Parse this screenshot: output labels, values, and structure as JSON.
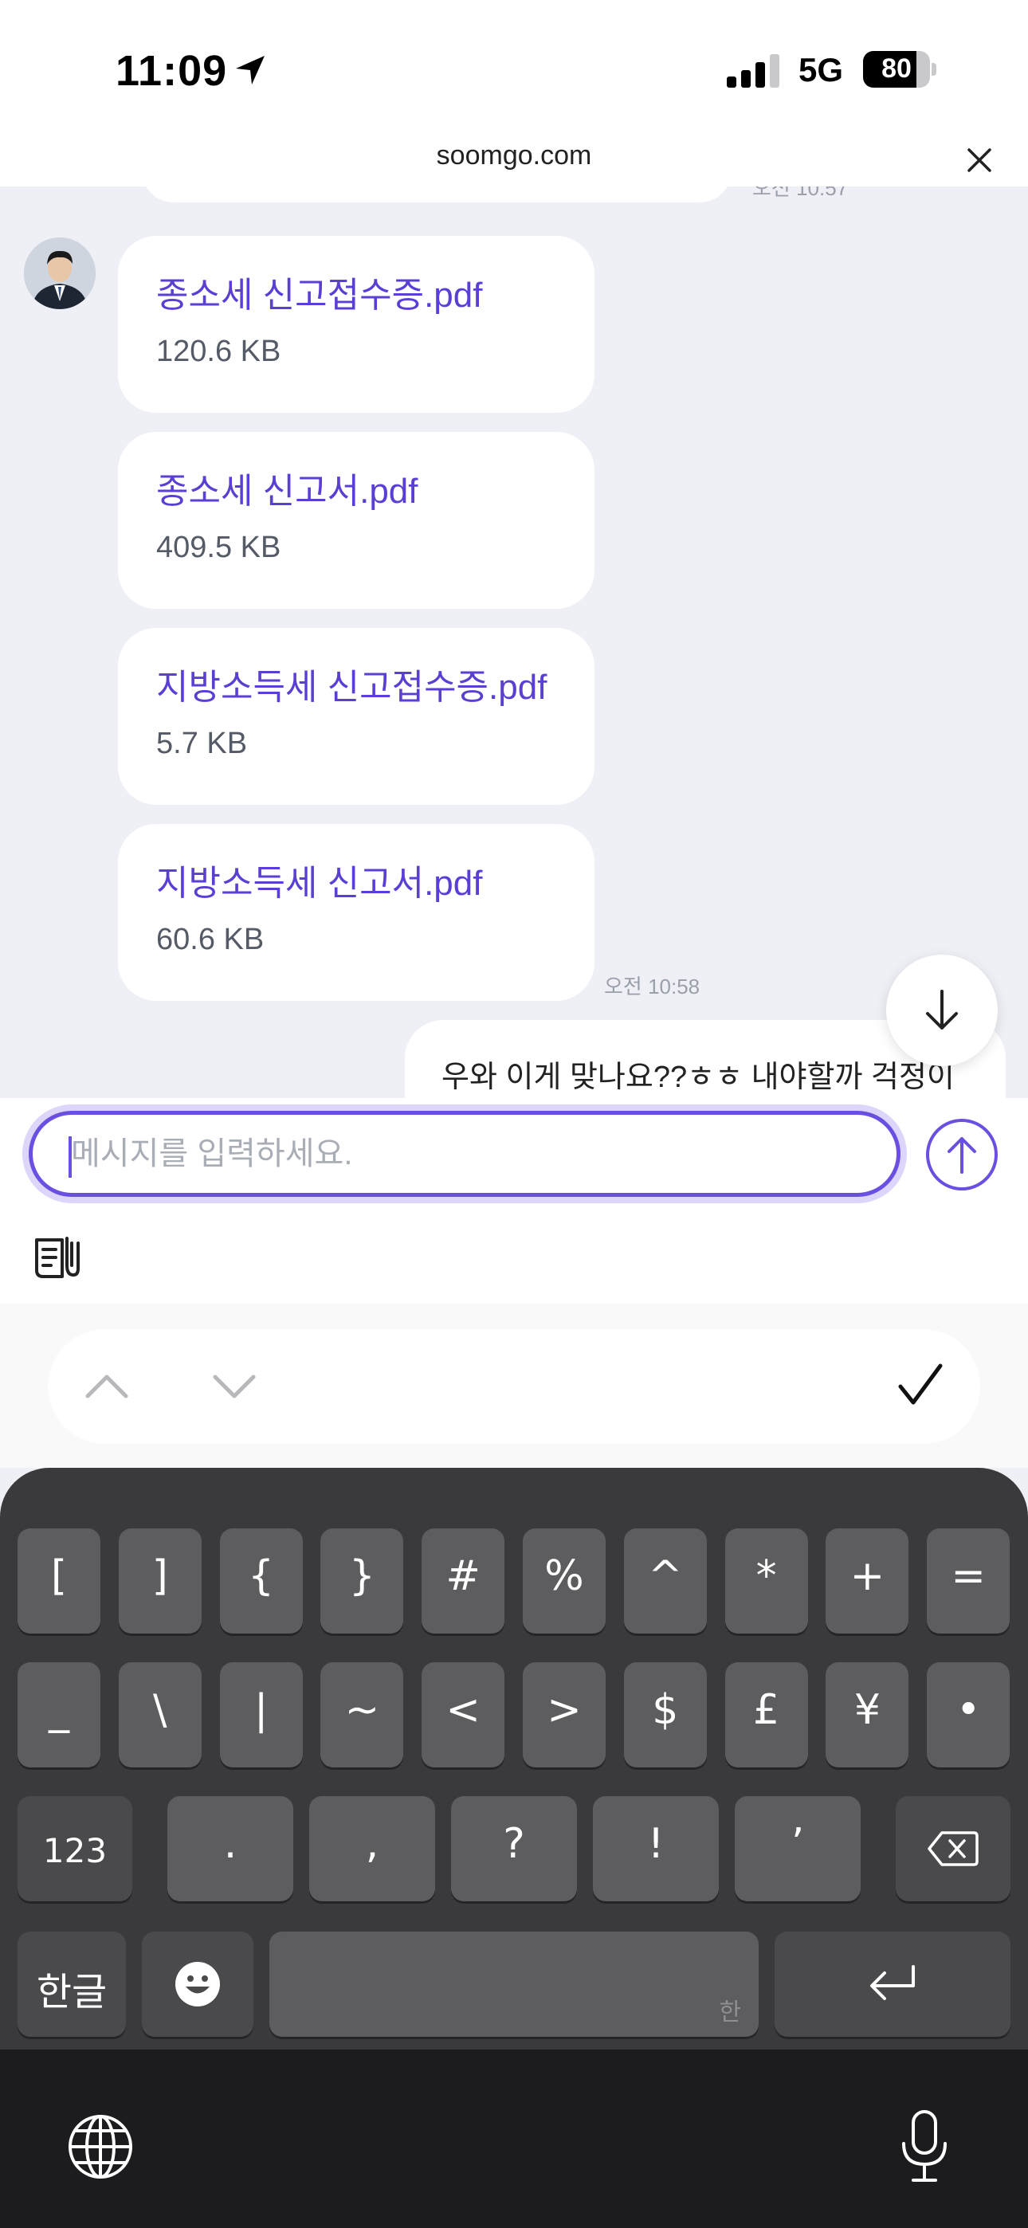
{
  "status_bar": {
    "time": "11:09",
    "network": "5G",
    "battery_percent": 80
  },
  "browser": {
    "url": "soomgo.com"
  },
  "chat": {
    "previous_time": "오전 10:57",
    "files": [
      {
        "name": "종소세 신고접수증.pdf",
        "size": "120.6 KB"
      },
      {
        "name": "종소세 신고서.pdf",
        "size": "409.5 KB"
      },
      {
        "name": "지방소득세 신고접수증.pdf",
        "size": "5.7 KB"
      },
      {
        "name": "지방소득세 신고서.pdf",
        "size": "60.6 KB"
      }
    ],
    "files_time": "오전 10:58",
    "my_message": "우와 이게 맞나요??ㅎㅎ 내야할까 걱정이"
  },
  "composer": {
    "placeholder": "메시지를 입력하세요."
  },
  "keyboard": {
    "row1": [
      "[",
      "]",
      "{",
      "}",
      "#",
      "%",
      "^",
      "*",
      "+",
      "="
    ],
    "row2": [
      "_",
      "\\",
      "|",
      "~",
      "<",
      ">",
      "$",
      "£",
      "¥",
      "•"
    ],
    "row3_left": "123",
    "row3_keys": [
      ".",
      ",",
      "?",
      "!",
      "’"
    ],
    "lang_key": "한글",
    "space_hint": "한"
  },
  "colors": {
    "accent": "#6b4fe0",
    "file_link": "#5b3fd4",
    "chat_bg": "#eef0f5"
  }
}
